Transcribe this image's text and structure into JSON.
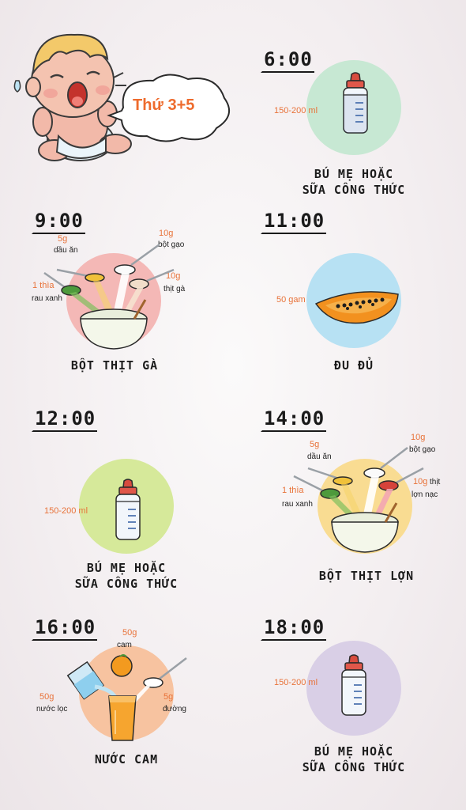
{
  "header": {
    "day_label": "Thứ 3+5"
  },
  "colors": {
    "accent": "#ee6b2d",
    "mint": "#c7e8d3",
    "pink": "#f4b8b6",
    "blue": "#b7e1f3",
    "lime": "#d6e99a",
    "yellow": "#f9dc92",
    "peach": "#f7c3a0",
    "lavender": "#d9cfe6"
  },
  "meals": [
    {
      "time": "6:00",
      "caption_1": "BÚ MẸ HOẶC",
      "caption_2": "SỮA CÔNG THỨC",
      "qty": "150-200 ml",
      "icon": "milk-bottle-icon"
    },
    {
      "time": "9:00",
      "caption_1": "BỘT THỊT GÀ",
      "ingredients": [
        {
          "amount": "5g",
          "name": "dầu ăn"
        },
        {
          "amount": "10g",
          "name": "bột gạo"
        },
        {
          "amount": "1 thìa",
          "name": "rau xanh"
        },
        {
          "amount": "10g",
          "name": "thịt gà"
        }
      ],
      "icon": "porridge-bowl-icon"
    },
    {
      "time": "11:00",
      "caption_1": "ĐU ĐỦ",
      "qty": "50 gam",
      "icon": "papaya-icon"
    },
    {
      "time": "12:00",
      "caption_1": "BÚ MẸ HOẶC",
      "caption_2": "SỮA CÔNG THỨC",
      "qty": "150-200 ml",
      "icon": "milk-bottle-icon"
    },
    {
      "time": "14:00",
      "caption_1": "BỘT THỊT LỢN",
      "ingredients": [
        {
          "amount": "5g",
          "name": "dầu ăn"
        },
        {
          "amount": "10g",
          "name": "bột gạo"
        },
        {
          "amount": "1 thìa",
          "name": "rau xanh"
        },
        {
          "amount": "10g",
          "name": "thịt"
        },
        {
          "amount": "",
          "name": "lợn nạc"
        }
      ],
      "icon": "porridge-bowl-icon"
    },
    {
      "time": "16:00",
      "caption_1": "NƯỚC CAM",
      "ingredients": [
        {
          "amount": "50g",
          "name": "cam"
        },
        {
          "amount": "50g",
          "name": "nước lọc"
        },
        {
          "amount": "5g",
          "name": "đường"
        }
      ],
      "icon": "orange-juice-icon"
    },
    {
      "time": "18:00",
      "caption_1": "BÚ MẸ HOẶC",
      "caption_2": "SỮA CÔNG THỨC",
      "qty": "150-200 ml",
      "icon": "milk-bottle-icon"
    }
  ]
}
